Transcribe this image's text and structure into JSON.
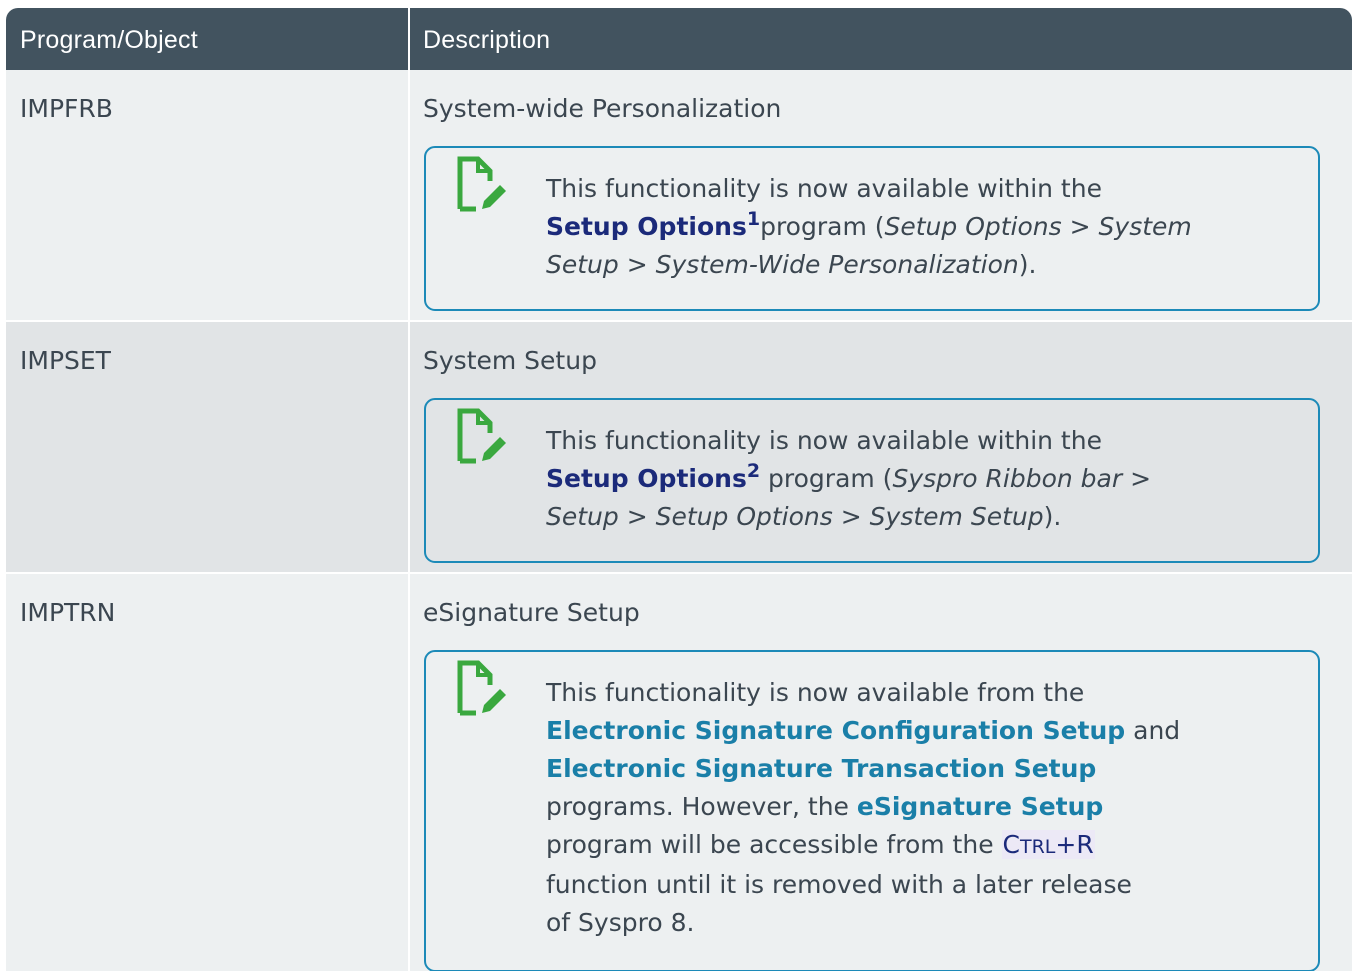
{
  "table": {
    "headers": [
      "Program/Object",
      "Description"
    ],
    "rows": [
      {
        "code": "IMPFRB",
        "description": "System-wide Personalization",
        "note": {
          "line1": "This functionality is now available within the",
          "link": "Setup Options",
          "link_sup": "1",
          "after_link": "program (",
          "path_a": "Setup Options",
          "gt1": " > ",
          "path_b": "System Setup",
          "gt2": " > ",
          "path_c": "System-Wide Personalization",
          "end": ")."
        }
      },
      {
        "code": "IMPSET",
        "description": "System Setup",
        "note": {
          "line1": "This functionality is now available within the",
          "link": "Setup Options",
          "link_sup": "2",
          "after_link": " program (",
          "path_a": "Syspro Ribbon bar",
          "gt1": " > ",
          "path_b": "Setup",
          "gt2": " > ",
          "path_c": "Setup Options",
          "gt3": " > ",
          "path_d": "System Setup",
          "end": ")."
        }
      },
      {
        "code": "IMPTRN",
        "description": "eSignature Setup",
        "note": {
          "line1": "This functionality is now available from the",
          "link1": "Electronic Signature Configuration Setup",
          "and": " and",
          "link2": "Electronic Signature Transaction Setup",
          "programs": "programs. However, the ",
          "link3": "eSignature Setup",
          "accessible": "program will be accessible from the ",
          "key_c": "C",
          "key_trl": "TRL",
          "key_r": "+R",
          "function_line": "function until it is removed with a later release",
          "last_line": "of Syspro 8."
        }
      }
    ]
  },
  "colors": {
    "header_bg": "#42535f",
    "row_light": "#edf0f1",
    "row_dark": "#e1e4e6",
    "note_border": "#1c8ab8",
    "icon_green": "#3aa83f",
    "link_navy": "#1b2a7a",
    "link_teal": "#1a7fa8"
  },
  "icons": [
    "note-edit-icon"
  ]
}
